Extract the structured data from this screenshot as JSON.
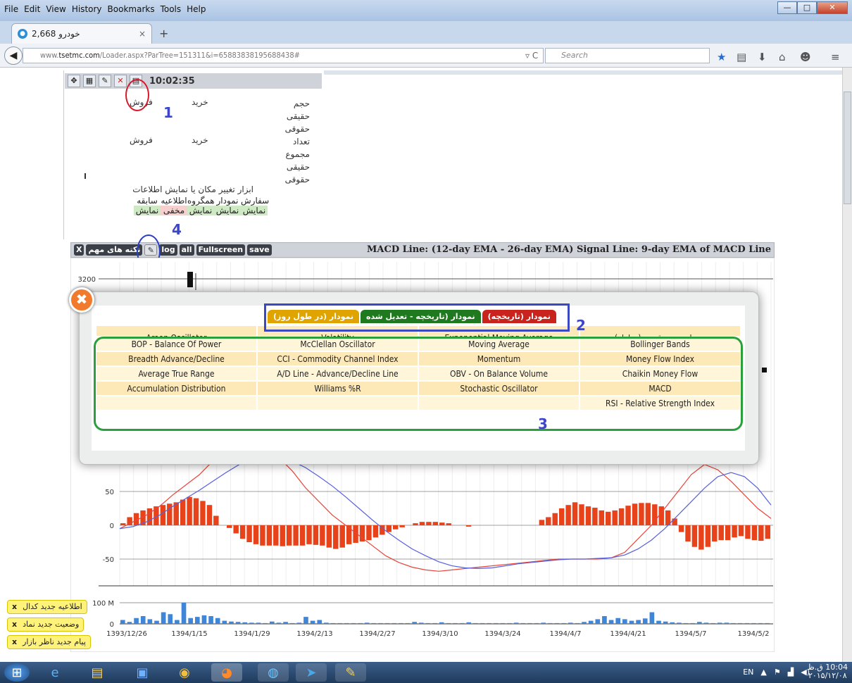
{
  "browser": {
    "menu": [
      "File",
      "Edit",
      "View",
      "History",
      "Bookmarks",
      "Tools",
      "Help"
    ],
    "tab_title": "خودرو 2,668",
    "url_prefix": "www.",
    "url_host": "tsetmc.com",
    "url_path": "/Loader.aspx?ParTree=151311&i=65883838195688438#",
    "search_placeholder": "Search"
  },
  "left_panel": {
    "time": "10:02:35",
    "buy": "خرید",
    "sell": "فروش",
    "rows_volume": [
      "حجم",
      "حقیقی",
      "حقوقی"
    ],
    "rows_count": [
      "تعداد",
      "مجموع",
      "حقیقی",
      "حقوقی"
    ],
    "tools_label": "ابزار تغییر مکان یا نمایش اطلاعات",
    "tools": [
      {
        "name": "سفارش",
        "state": "نمایش",
        "color": "#cfe9c5"
      },
      {
        "name": "نمودار",
        "state": "نمایش",
        "color": "#cfe9c5"
      },
      {
        "name": "همگروه",
        "state": "نمایش",
        "color": "#cfe9c5"
      },
      {
        "name": "اطلاعیه",
        "state": "مخفی",
        "color": "#f6cfcf"
      },
      {
        "name": "سابقه",
        "state": "نمایش",
        "color": "#cfe9c5"
      }
    ]
  },
  "annotations": [
    "1",
    "2",
    "3",
    "4"
  ],
  "chart_toolbar": {
    "close": "X",
    "notes": "نکته های مهم",
    "log": "log",
    "all": "all",
    "fullscreen": "Fullscreen",
    "save": "save",
    "title": "MACD Line: (12-day EMA - 26-day EMA) Signal Line: 9-day EMA of MACD Line"
  },
  "modal": {
    "close": "✖",
    "tabs": [
      {
        "label": "نمودار (تاریخچه)",
        "color": "#c8231c"
      },
      {
        "label": "نمودار (تاریخچه - تعدیل شده",
        "color": "#1f7a1f"
      },
      {
        "label": "نمودار (در طول روز)",
        "color": "#e0a400"
      }
    ],
    "hidden_row": [
      "Aroon Oscillator",
      "Volatility",
      "Exponential Moving Average",
      "نمودار حجم - قیمت (معامله)"
    ],
    "rows": [
      [
        "BOP - Balance Of Power",
        "McClellan Oscillator",
        "Moving Average",
        "Bollinger Bands"
      ],
      [
        "Breadth Advance/Decline",
        "CCI - Commodity Channel Index",
        "Momentum",
        "Money Flow Index"
      ],
      [
        "Average True Range",
        "A/D Line - Advance/Decline Line",
        "OBV - On Balance Volume",
        "Chaikin Money Flow"
      ],
      [
        "Accumulation Distribution",
        "Williams %R",
        "Stochastic Oscillator",
        "MACD"
      ],
      [
        "",
        "",
        "",
        "RSI - Relative Strength Index"
      ]
    ]
  },
  "chart_data": {
    "type": "bar",
    "title": "MACD Line: (12-day EMA - 26-day EMA) Signal Line: 9-day EMA of MACD Line",
    "price_tick": "3200",
    "macd_ticks": [
      "50",
      "0",
      "-50"
    ],
    "macd_ylim": [
      -90,
      100
    ],
    "volume_ticks": [
      "100 M",
      "0"
    ],
    "x_ticks": [
      "1393/12/26",
      "1394/1/15",
      "1394/1/29",
      "1394/2/13",
      "1394/2/27",
      "1394/3/10",
      "1394/3/24",
      "1394/4/7",
      "1394/4/21",
      "1394/5/7",
      "1394/5/2"
    ],
    "histogram": [
      3,
      12,
      18,
      22,
      25,
      28,
      30,
      32,
      34,
      38,
      42,
      40,
      36,
      30,
      14,
      0,
      -4,
      -12,
      -20,
      -25,
      -28,
      -30,
      -30,
      -30,
      -31,
      -30,
      -30,
      -30,
      -28,
      -29,
      -30,
      -33,
      -35,
      -33,
      -28,
      -26,
      -24,
      -22,
      -18,
      -14,
      -10,
      -6,
      -3,
      0,
      3,
      5,
      5,
      5,
      4,
      3,
      0,
      0,
      -2,
      0,
      0,
      0,
      0,
      0,
      0,
      0,
      0,
      0,
      0,
      8,
      12,
      18,
      25,
      30,
      34,
      31,
      28,
      26,
      22,
      20,
      22,
      25,
      29,
      32,
      33,
      33,
      31,
      28,
      22,
      10,
      -10,
      -24,
      -32,
      -36,
      -32,
      -24,
      -22,
      -22,
      -18,
      -16,
      -20,
      -22,
      -23,
      -20
    ],
    "macd_line": [
      -5,
      5,
      15,
      28,
      45,
      60,
      75,
      95,
      110,
      125,
      130,
      120,
      100,
      80,
      55,
      35,
      15,
      0,
      -15,
      -30,
      -45,
      -55,
      -62,
      -66,
      -68,
      -66,
      -64,
      -62,
      -60,
      -58,
      -56,
      -54,
      -52,
      -50,
      -50,
      -50,
      -50,
      -48,
      -40,
      -20,
      0,
      25,
      50,
      75,
      90,
      82,
      65,
      45,
      25,
      10
    ],
    "signal_line": [
      -5,
      -2,
      5,
      15,
      28,
      40,
      52,
      65,
      78,
      90,
      100,
      105,
      102,
      95,
      85,
      72,
      58,
      42,
      25,
      8,
      -8,
      -22,
      -35,
      -45,
      -54,
      -60,
      -63,
      -64,
      -63,
      -60,
      -57,
      -55,
      -53,
      -51,
      -50,
      -50,
      -49,
      -48,
      -44,
      -35,
      -22,
      -5,
      15,
      35,
      55,
      72,
      78,
      72,
      55,
      30
    ],
    "volume": [
      10,
      5,
      15,
      20,
      12,
      8,
      30,
      25,
      10,
      55,
      15,
      18,
      22,
      20,
      15,
      8,
      6,
      5,
      4,
      3,
      3,
      2,
      6,
      3,
      5,
      2,
      3,
      18,
      8,
      10,
      3,
      2,
      2,
      2,
      2,
      2,
      3,
      2,
      2,
      2,
      2,
      2,
      2,
      5,
      3,
      2,
      2,
      4,
      2,
      2,
      2,
      4,
      2,
      2,
      2,
      2,
      2,
      2,
      3,
      2,
      2,
      2,
      3,
      2,
      2,
      2,
      3,
      2,
      5,
      8,
      12,
      20,
      10,
      15,
      12,
      8,
      10,
      14,
      30,
      8,
      6,
      4,
      3,
      2,
      2,
      5,
      3,
      2,
      3,
      3,
      2,
      2,
      2,
      2,
      2,
      2
    ]
  },
  "notices": [
    "اطلاعیه جدید کدال",
    "وضعیت جدید نماد",
    "پیام جدید ناظر بازار"
  ],
  "notice_close": "x",
  "taskbar": {
    "lang": "EN",
    "time": "10:04 ق.ظ",
    "date": "۲۰۱۵/۱۲/۰۸"
  }
}
